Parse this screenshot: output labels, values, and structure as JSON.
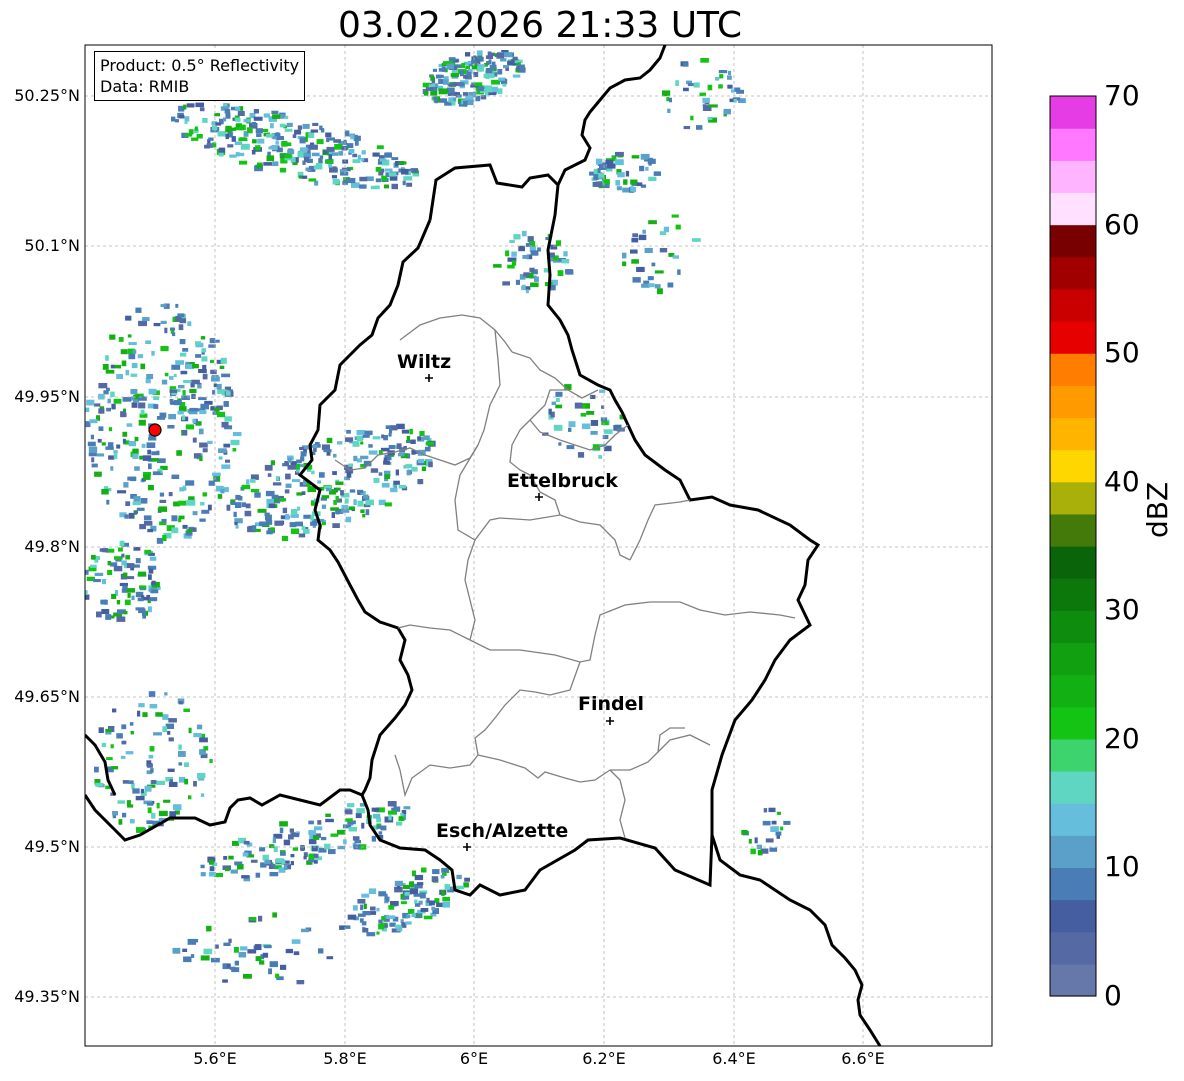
{
  "title": "03.02.2026 21:33 UTC",
  "info": {
    "product_line": "Product: 0.5° Reflectivity",
    "data_line": "Data: RMIB"
  },
  "lat_labels": [
    "50.25°N",
    "50.1°N",
    "49.95°N",
    "49.8°N",
    "49.65°N",
    "49.5°N",
    "49.35°N"
  ],
  "lon_labels": [
    "5.6°E",
    "5.8°E",
    "6°E",
    "6.2°E",
    "6.4°E",
    "6.6°E"
  ],
  "cities": [
    {
      "name": "Wiltz"
    },
    {
      "name": "Ettelbruck"
    },
    {
      "name": "Findel"
    },
    {
      "name": "Esch/Alzette"
    }
  ],
  "colorbar": {
    "label": "dBZ",
    "ticks": [
      "70",
      "60",
      "50",
      "40",
      "30",
      "20",
      "10",
      "0"
    ],
    "min": 0,
    "max": 70,
    "colors": [
      "#6677a9",
      "#556aa4",
      "#445ea0",
      "#4a7db5",
      "#5aa0c8",
      "#66bedd",
      "#5fd6c2",
      "#3ed46d",
      "#14c414",
      "#12b012",
      "#10a010",
      "#0e8c0e",
      "#0c780c",
      "#0a640a",
      "#447a0a",
      "#aab00a",
      "#ffd700",
      "#ffb400",
      "#ff9a00",
      "#ff7d00",
      "#e60000",
      "#c80000",
      "#a00000",
      "#780000",
      "#ffe0ff",
      "#ffb4ff",
      "#ff78ff",
      "#e63ce6"
    ]
  },
  "colors": {
    "border_country": "#000000",
    "border_canton": "#808080",
    "grid": "#b4b4b4",
    "radar_site": "#ff0000"
  }
}
